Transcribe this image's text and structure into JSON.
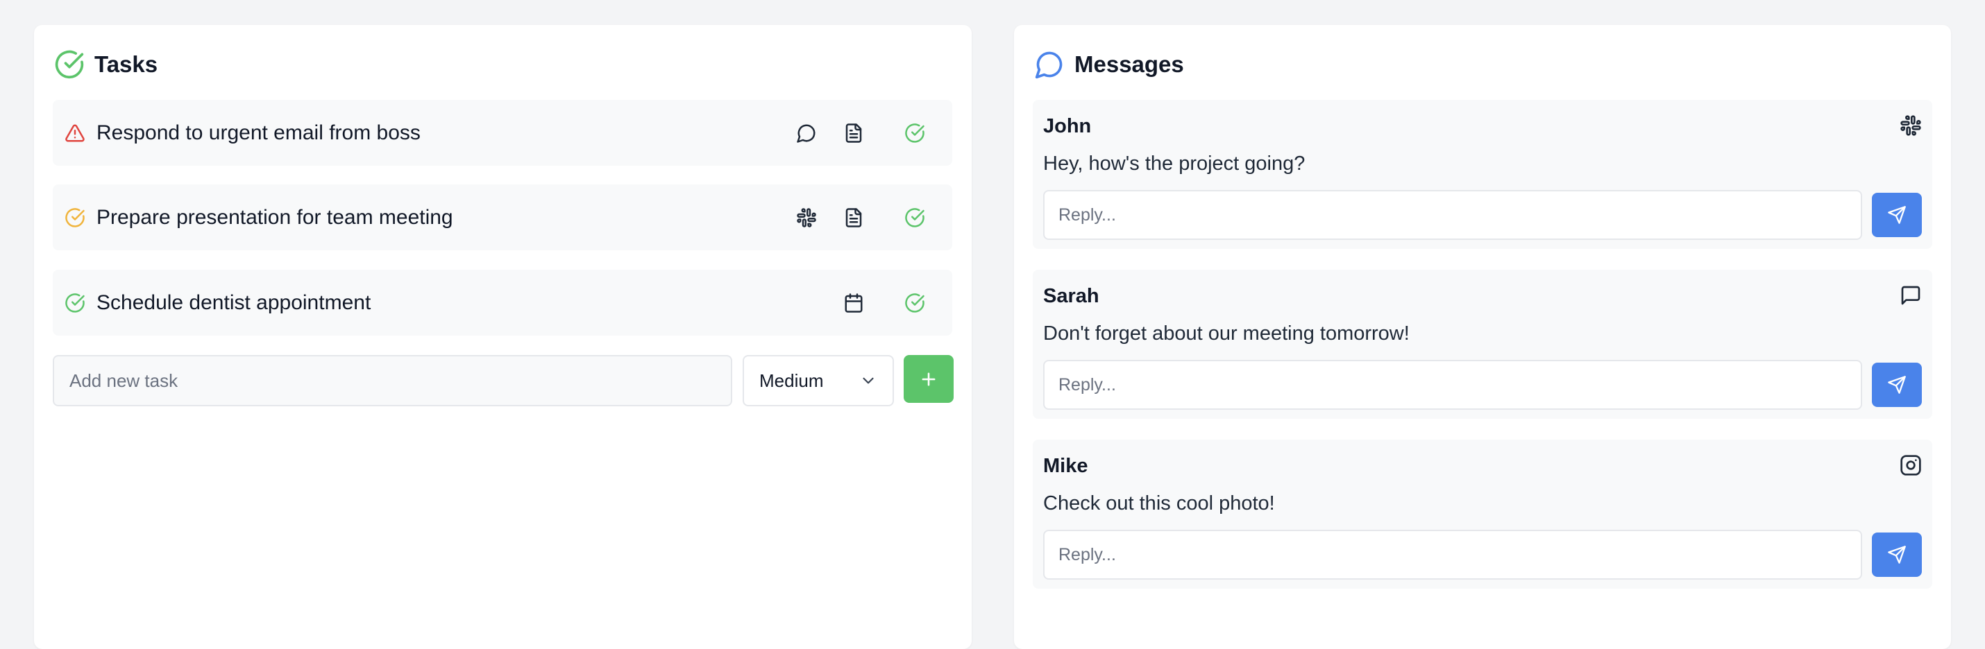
{
  "colors": {
    "background": "#f3f4f6",
    "panel": "#ffffff",
    "row": "#f8f9fa",
    "success": "#5cc46a",
    "warning": "#f0b43c",
    "danger": "#e0453f",
    "primary": "#4a83ea"
  },
  "tasks_panel": {
    "title": "Tasks",
    "icon": "check-circle-icon",
    "tasks": [
      {
        "text": "Respond to urgent email from boss",
        "priority_icon": "alert-triangle-icon",
        "source_icons": [
          "chat-bubble-icon",
          "document-icon"
        ],
        "complete_icon": "check-circle-icon"
      },
      {
        "text": "Prepare presentation for team meeting",
        "priority_icon": "check-circle-icon",
        "source_icons": [
          "slack-icon",
          "document-icon"
        ],
        "complete_icon": "check-circle-icon"
      },
      {
        "text": "Schedule dentist appointment",
        "priority_icon": "check-circle-icon",
        "source_icons": [
          "calendar-icon"
        ],
        "complete_icon": "check-circle-icon"
      }
    ],
    "new_task": {
      "placeholder": "Add new task",
      "priority_selected": "Medium",
      "add_icon": "plus-icon"
    }
  },
  "messages_panel": {
    "title": "Messages",
    "icon": "chat-bubble-icon",
    "messages": [
      {
        "sender": "John",
        "text": "Hey, how's the project going?",
        "source_icon": "slack-icon",
        "reply_placeholder": "Reply..."
      },
      {
        "sender": "Sarah",
        "text": "Don't forget about our meeting tomorrow!",
        "source_icon": "message-square-icon",
        "reply_placeholder": "Reply..."
      },
      {
        "sender": "Mike",
        "text": "Check out this cool photo!",
        "source_icon": "instagram-icon",
        "reply_placeholder": "Reply..."
      }
    ],
    "send_icon": "send-icon"
  }
}
